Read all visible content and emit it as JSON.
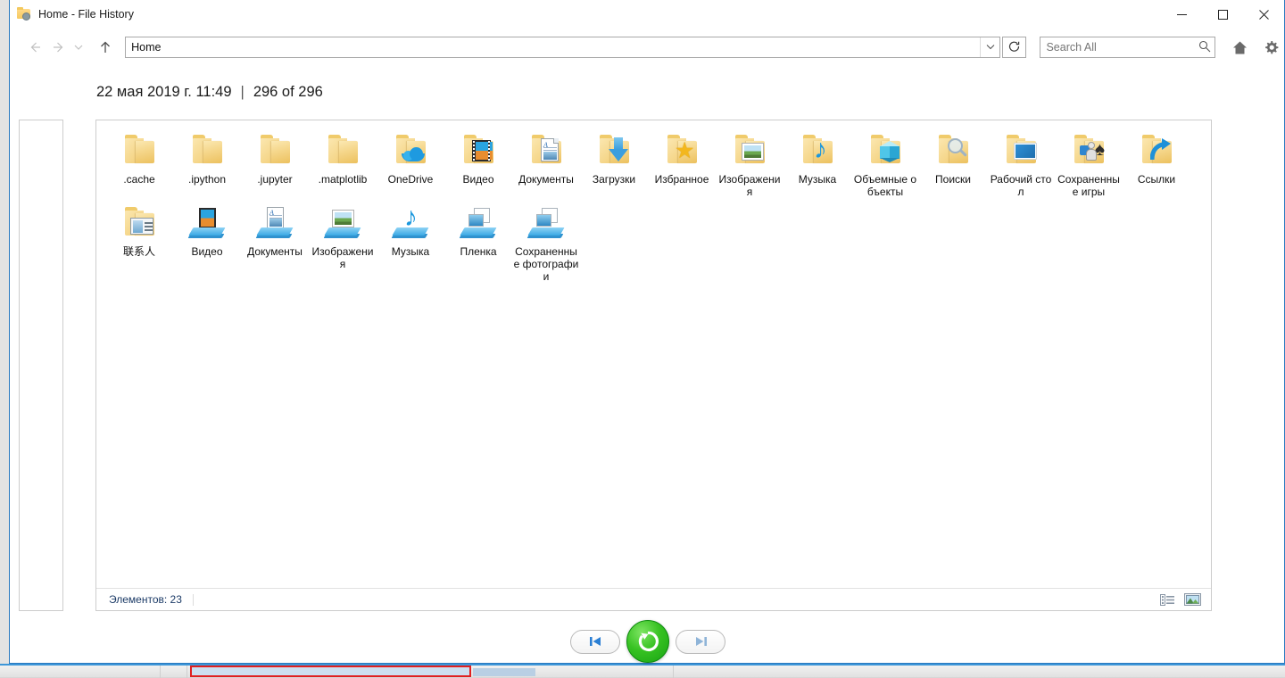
{
  "window": {
    "title": "Home - File History",
    "app_icon": "folder-history-icon",
    "controls": {
      "minimize": "—",
      "maximize": "□",
      "close": "✕"
    }
  },
  "toolbar": {
    "back_glyph": "←",
    "forward_glyph": "→",
    "recent_glyph": "⌄",
    "up_glyph": "↑",
    "address_value": "Home",
    "address_chevron": "⌄",
    "refresh_glyph": "↻",
    "search_placeholder": "Search All",
    "search_value": "",
    "search_glyph": "⌕",
    "home_label": "Home",
    "settings_label": "Settings"
  },
  "header": {
    "timestamp": "22 мая 2019 г. 11:49",
    "separator": "|",
    "position": "296 of 296"
  },
  "nav_pane": {
    "items": []
  },
  "content": {
    "items": [
      {
        "label": ".cache",
        "icon": "folder-icon",
        "kind": "folder"
      },
      {
        "label": ".ipython",
        "icon": "folder-icon",
        "kind": "folder"
      },
      {
        "label": ".jupyter",
        "icon": "folder-icon",
        "kind": "folder"
      },
      {
        "label": ".matplotlib",
        "icon": "folder-icon",
        "kind": "folder"
      },
      {
        "label": "OneDrive",
        "icon": "folder-onedrive-icon",
        "kind": "folder-cloud"
      },
      {
        "label": "Видео",
        "icon": "folder-videos-icon",
        "kind": "folder-film"
      },
      {
        "label": "Документы",
        "icon": "folder-documents-icon",
        "kind": "folder-doc"
      },
      {
        "label": "Загрузки",
        "icon": "folder-downloads-icon",
        "kind": "folder-download"
      },
      {
        "label": "Избранное",
        "icon": "folder-favorites-icon",
        "kind": "folder-star"
      },
      {
        "label": "Изображения",
        "icon": "folder-pictures-icon",
        "kind": "folder-picture"
      },
      {
        "label": "Музыка",
        "icon": "folder-music-icon",
        "kind": "folder-note"
      },
      {
        "label": "Объемные объекты",
        "icon": "folder-3dobjects-icon",
        "kind": "folder-cube"
      },
      {
        "label": "Поиски",
        "icon": "folder-searches-icon",
        "kind": "folder-magnifier"
      },
      {
        "label": "Рабочий стол",
        "icon": "folder-desktop-icon",
        "kind": "folder-monitor"
      },
      {
        "label": "Сохраненные игры",
        "icon": "folder-savedgames-icon",
        "kind": "folder-games"
      },
      {
        "label": "Ссылки",
        "icon": "folder-links-icon",
        "kind": "folder-link"
      },
      {
        "label": "联系人",
        "icon": "folder-contacts-icon",
        "kind": "folder-contact"
      },
      {
        "label": "Видео",
        "icon": "library-videos-icon",
        "kind": "lib-film"
      },
      {
        "label": "Документы",
        "icon": "library-documents-icon",
        "kind": "lib-doc"
      },
      {
        "label": "Изображения",
        "icon": "library-pictures-icon",
        "kind": "lib-pic"
      },
      {
        "label": "Музыка",
        "icon": "library-music-icon",
        "kind": "lib-note"
      },
      {
        "label": "Пленка",
        "icon": "library-camera-roll-icon",
        "kind": "lib-photos"
      },
      {
        "label": "Сохраненные фотографии",
        "icon": "library-saved-pictures-icon",
        "kind": "lib-photos"
      }
    ]
  },
  "status_bar": {
    "item_count_text": "Элементов: 23",
    "view_details_label": "Details view",
    "view_icons_label": "Large icons view"
  },
  "transport": {
    "prev_label": "Previous version",
    "prev_glyph": "⏮",
    "restore_label": "Restore",
    "next_label": "Next version",
    "next_glyph": "⏭"
  },
  "colors": {
    "window_border": "#2a7ac0",
    "accent_blue": "#1e90d8",
    "restore_green": "#37c222",
    "highlight_red": "#e02020",
    "status_text": "#1b3a66"
  }
}
